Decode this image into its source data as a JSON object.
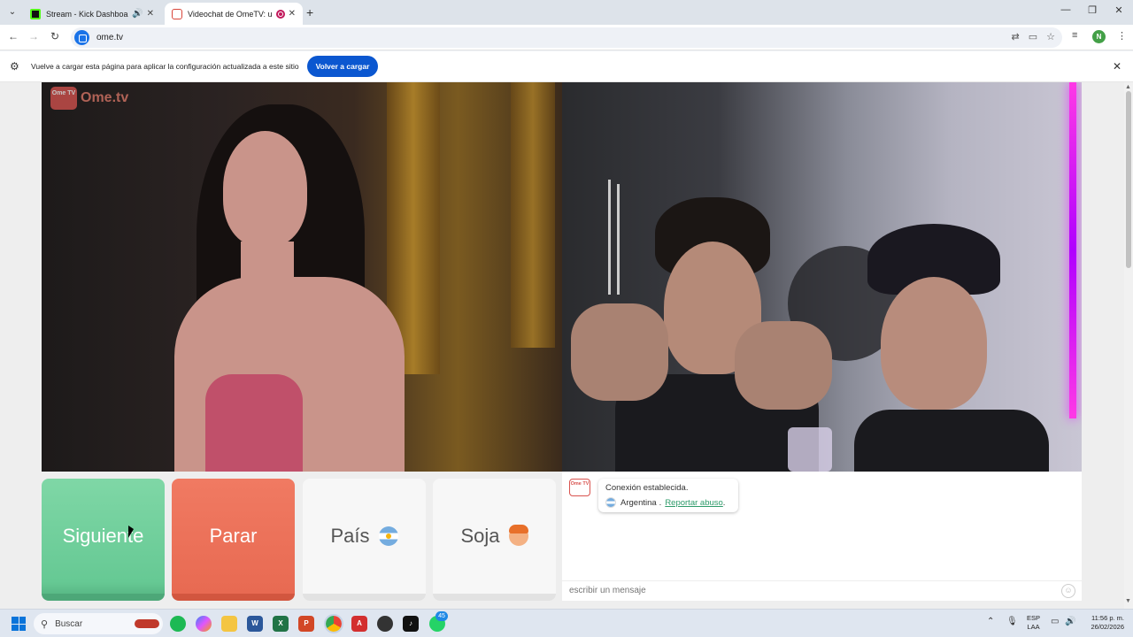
{
  "browser": {
    "tabs": [
      {
        "title": "Stream - Kick Dashboard",
        "favicon": "kick-icon",
        "audio": true
      },
      {
        "title": "Videochat de OmeTV: una",
        "favicon": "ometv-icon",
        "recording": true,
        "active": true
      }
    ],
    "new_tab_symbol": "+",
    "url": "ome.tv",
    "profile_initial": "N"
  },
  "infobar": {
    "message": "Vuelve a cargar esta página para aplicar la configuración actualizada a este sitio",
    "button_label": "Volver a cargar"
  },
  "logo": {
    "badge": "Ome TV",
    "text": "Ome.tv"
  },
  "controls": {
    "next_label": "Siguiente",
    "stop_label": "Parar",
    "country_label": "País",
    "gender_label": "Soja",
    "colors": {
      "next": "#6fcf9c",
      "stop": "#ea6e56",
      "neutral": "#f7f7f7"
    }
  },
  "chat": {
    "status": "Conexión establecida.",
    "country": "Argentina",
    "separator": ".",
    "report_link": "Reportar abuso",
    "report_suffix": ".",
    "input_placeholder": "escribir un mensaje"
  },
  "taskbar": {
    "search_placeholder": "Buscar",
    "whatsapp_badge": "45",
    "lang_line1": "ESP",
    "lang_line2": "LAA",
    "time": "11:56 p. m.",
    "date": "26/02/2026"
  }
}
